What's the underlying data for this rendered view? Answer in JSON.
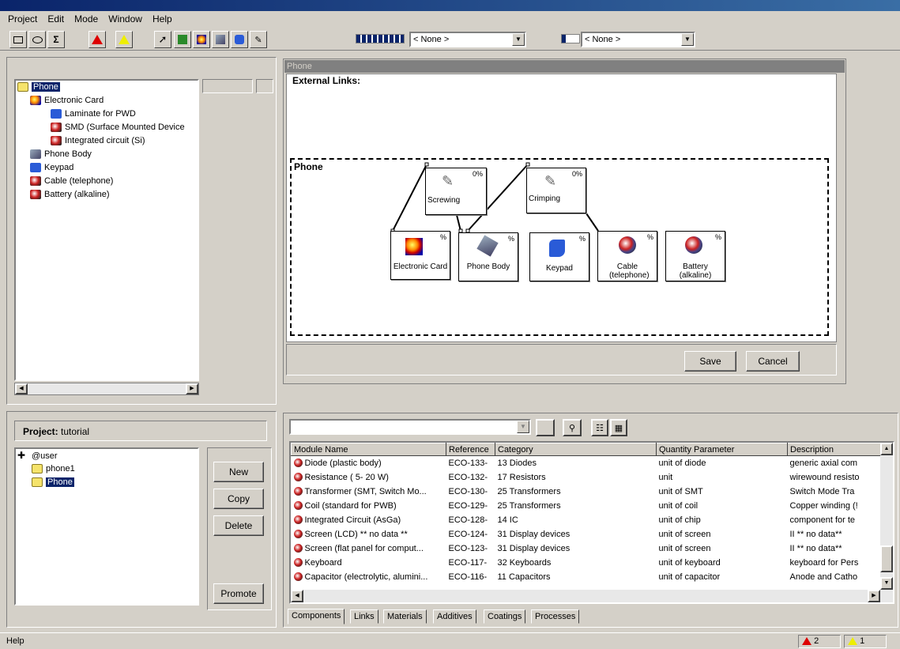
{
  "menu": [
    "Project",
    "Edit",
    "Mode",
    "Window",
    "Help"
  ],
  "toolbar": {
    "combo1": "< None >",
    "combo2": "< None >",
    "sigma": "Σ"
  },
  "tree": {
    "items": [
      {
        "label": "Phone",
        "level": 0,
        "icon": "folder-icon",
        "selected": true
      },
      {
        "label": "Electronic Card",
        "level": 1,
        "icon": "card-icon"
      },
      {
        "label": "Laminate for PWD",
        "level": 2,
        "icon": "material-icon"
      },
      {
        "label": "SMD (Surface Mounted Device",
        "level": 2,
        "icon": "component-ball-icon"
      },
      {
        "label": "Integrated circuit (Si)",
        "level": 2,
        "icon": "component-ball-icon"
      },
      {
        "label": "Phone Body",
        "level": 1,
        "icon": "body-icon"
      },
      {
        "label": "Keypad",
        "level": 1,
        "icon": "material-icon"
      },
      {
        "label": "Cable (telephone)",
        "level": 1,
        "icon": "component-ball-icon"
      },
      {
        "label": "Battery (alkaline)",
        "level": 1,
        "icon": "component-ball-icon"
      }
    ]
  },
  "editor": {
    "window_title": "Phone",
    "external_links": "External Links:",
    "group_label": "Phone",
    "processes": [
      {
        "name": "Screwing",
        "pct": "0%"
      },
      {
        "name": "Crimping",
        "pct": "0%"
      }
    ],
    "modules": [
      {
        "name": "Electronic Card",
        "pct": "%"
      },
      {
        "name": "Phone Body",
        "pct": "%"
      },
      {
        "name": "Keypad",
        "pct": "%"
      },
      {
        "name": "Cable (telephone)",
        "pct": "%"
      },
      {
        "name": "Battery (alkaline)",
        "pct": "%"
      }
    ],
    "save": "Save",
    "cancel": "Cancel"
  },
  "project": {
    "label": "Project:",
    "name": "tutorial",
    "tree": [
      {
        "label": "@user",
        "level": 0
      },
      {
        "label": "phone1",
        "level": 1
      },
      {
        "label": "Phone",
        "level": 1,
        "selected": true
      }
    ],
    "buttons": {
      "new": "New",
      "copy": "Copy",
      "delete": "Delete",
      "promote": "Promote"
    }
  },
  "grid": {
    "columns": [
      "Module Name",
      "Reference",
      "Category",
      "Quantity Parameter",
      "Description"
    ],
    "rows": [
      [
        "Diode (plastic body)",
        "ECO-133-",
        "13 Diodes",
        "unit of diode",
        "generic axial com"
      ],
      [
        "Resistance ( 5- 20 W)",
        "ECO-132-",
        "17 Resistors",
        "unit",
        "wirewound resisto"
      ],
      [
        "Transformer (SMT, Switch Mo...",
        "ECO-130-",
        "25 Transformers",
        "unit of SMT",
        "Switch Mode Tra"
      ],
      [
        "Coil (standard for PWB)",
        "ECO-129-",
        "25 Transformers",
        "unit of  coil",
        "Copper winding (!"
      ],
      [
        "Integrated Circuit (AsGa)",
        "ECO-128-",
        "14 IC",
        "unit of  chip",
        "component for te"
      ],
      [
        "Screen (LCD) ** no data **",
        "ECO-124-",
        "31 Display devices",
        "unit of screen",
        "II ** no data**"
      ],
      [
        "Screen (flat panel for comput...",
        "ECO-123-",
        "31 Display devices",
        "unit of screen",
        "II ** no data**"
      ],
      [
        "Keyboard",
        "ECO-117-",
        "32 Keyboards",
        "unit of  keyboard",
        "keyboard for Pers"
      ],
      [
        "Capacitor (electrolytic, alumini...",
        "ECO-116-",
        "11 Capacitors",
        "unit of capacitor",
        "Anode and Catho"
      ]
    ]
  },
  "tabs": [
    "Components",
    "Links",
    "Materials",
    "Additives",
    "Coatings",
    "Processes"
  ],
  "status": {
    "text": "Help",
    "errors": "2",
    "warnings": "1"
  }
}
